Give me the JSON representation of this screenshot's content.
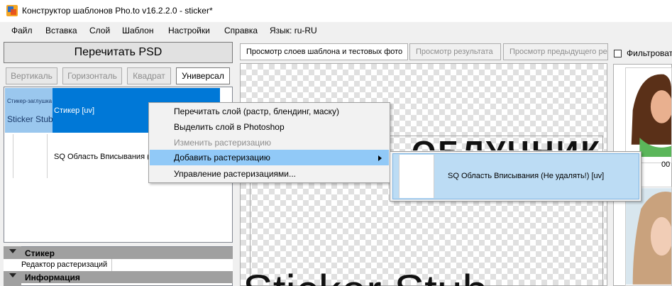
{
  "window": {
    "title": "Конструктор шаблонов Pho.to v16.2.2.0 - sticker*",
    "icon": "app-icon"
  },
  "menubar": {
    "items": [
      "Файл",
      "Вставка",
      "Слой",
      "Шаблон",
      "Настройки",
      "Справка",
      "Язык: ru-RU"
    ]
  },
  "left_panel": {
    "reread_button": "Перечитать PSD",
    "mode_buttons": [
      "Вертикаль",
      "Горизонталь",
      "Квадрат",
      "Универсал"
    ],
    "active_mode": "Универсал",
    "layers": [
      {
        "thumb_small": "Стикер-заглушка",
        "thumb_big": "Sticker Stub",
        "label": "Стикер [uv]",
        "selected": true
      },
      {
        "label": "SQ Область Вписывания ("
      }
    ],
    "properties": {
      "categories": [
        "Стикер",
        "Информация"
      ],
      "rows": [
        {
          "name": "Редактор растеризаций",
          "value": ""
        }
      ]
    }
  },
  "tabs": [
    {
      "label": "Просмотр слоев шаблона и тестовых фото",
      "state": "active"
    },
    {
      "label": "Просмотр результата",
      "state": "disabled"
    },
    {
      "label": "Просмотр предыдущего ре",
      "state": "disabled"
    }
  ],
  "preview": {
    "text_top": "ОБЛУЧНИК",
    "text_bottom": "Sticker Stub"
  },
  "right_panel": {
    "filter_label": "Фильтровать",
    "filter_checked": false,
    "thumbnails": [
      {
        "number": "00"
      },
      {
        "number": ""
      }
    ]
  },
  "context_menu": {
    "items": [
      {
        "label": "Перечитать слой (растр, блендинг, маску)",
        "enabled": true
      },
      {
        "label": "Выделить слой в Photoshop",
        "enabled": true
      },
      {
        "label": "Изменить растеризацию",
        "enabled": false
      },
      {
        "label": "Добавить растеризацию",
        "enabled": true,
        "submenu": true,
        "highlighted": true
      },
      {
        "label": "Управление растеризациями...",
        "enabled": true
      }
    ]
  },
  "submenu": {
    "items": [
      {
        "label": "SQ Область Вписывания (Не удалять!) [uv]"
      }
    ]
  },
  "colors": {
    "selection": "#0078d7",
    "menu_highlight": "#91c9f7",
    "submenu_highlight": "#bcdcf4",
    "category_bar": "#a0a0a0"
  }
}
